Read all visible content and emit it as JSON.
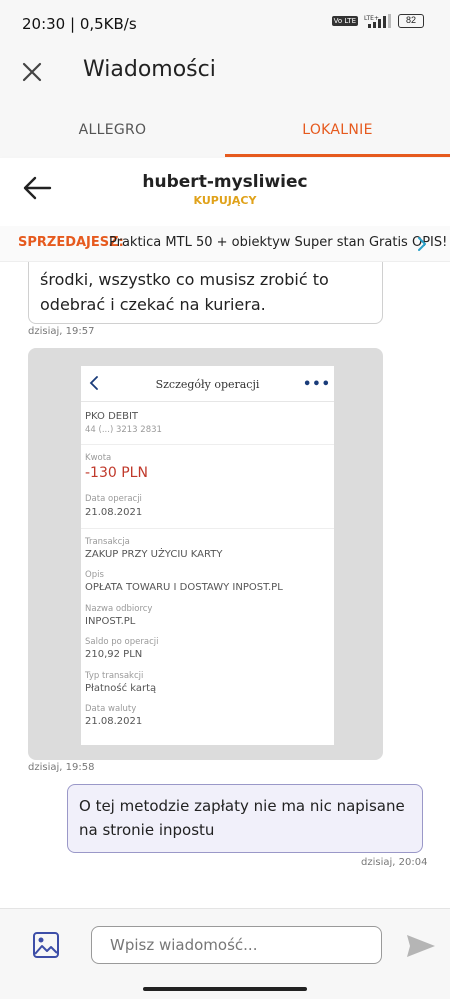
{
  "status_bar": {
    "time": "20:30 | 0,5KB/s",
    "network": "LTE+",
    "volte": "Vo LTE",
    "battery": "82"
  },
  "app_bar": {
    "title": "Wiadomości"
  },
  "tabs": [
    {
      "label": "ALLEGRO",
      "active": false
    },
    {
      "label": "LOKALNIE",
      "active": true
    }
  ],
  "chat": {
    "user_name": "hubert-mysliwiec",
    "user_role": "KUPUJĄCY"
  },
  "offer_bar": {
    "prefix": "SPRZEDAJESZ:",
    "title": "Praktica MTL 50 + obiektyw Super stan Gratis OPIS!"
  },
  "messages": [
    {
      "direction": "incoming",
      "text": "środki, wszystko co musisz zrobić to odebrać i czekać na kuriera.",
      "time": "dzisiaj, 19:57"
    },
    {
      "direction": "incoming",
      "type": "image",
      "time": "dzisiaj, 19:58"
    },
    {
      "direction": "outgoing",
      "text": "O tej metodzie zapłaty nie ma nic napisane na stronie inpostu",
      "time": "dzisiaj, 20:04"
    }
  ],
  "receipt": {
    "title": "Szczegóły operacji",
    "more": "•••",
    "account_name": "PKO DEBIT",
    "account_number": "44 (...) 3213 2831",
    "amount_label": "Kwota",
    "amount": "-130 PLN",
    "op_date_label": "Data operacji",
    "op_date": "21.08.2021",
    "transaction_label": "Transakcja",
    "transaction": "ZAKUP PRZY UŻYCIU KARTY",
    "description_label": "Opis",
    "description": "OPŁATA TOWARU I DOSTAWY INPOST.PL",
    "recipient_label": "Nazwa odbiorcy",
    "recipient": "INPOST.PL",
    "balance_label": "Saldo po operacji",
    "balance": "210,92 PLN",
    "type_label": "Typ transakcji",
    "type": "Płatność kartą",
    "value_date_label": "Data waluty",
    "value_date": "21.08.2021"
  },
  "composer": {
    "placeholder": "Wpisz wiadomość..."
  },
  "colors": {
    "accent": "#e65a1e",
    "role": "#e0a21a",
    "outgoing_bubble_border": "#9a98c8",
    "outgoing_bubble_bg": "#f1f0fa"
  }
}
